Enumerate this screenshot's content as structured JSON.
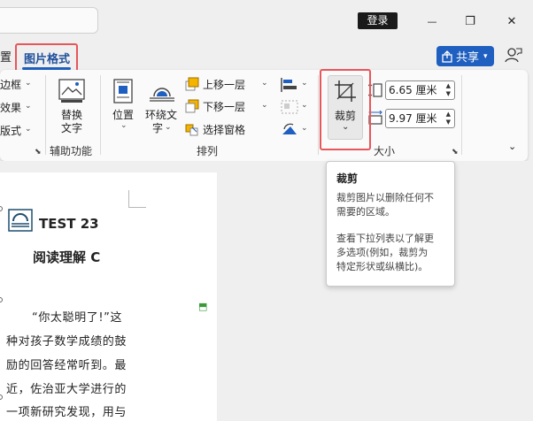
{
  "titlebar": {
    "login_label": "登录",
    "minimize_glyph": "—",
    "restore_glyph": "❐",
    "close_glyph": "✕"
  },
  "tabs": {
    "partial_tab": "置",
    "picture_format": "图片格式"
  },
  "share": {
    "label": "共享",
    "chevron": "⌄"
  },
  "ribbon": {
    "border_label": "边框",
    "effects_label": "效果",
    "layout_label": "版式",
    "alt_text_l1": "替换",
    "alt_text_l2": "文字",
    "accessibility_group": "辅助功能",
    "position_label": "位置",
    "wrap_text_l1": "环绕文",
    "wrap_text_l2": "字",
    "bring_forward": "上移一层",
    "send_backward": "下移一层",
    "selection_pane": "选择窗格",
    "arrange_group": "排列",
    "crop_label": "裁剪",
    "height_value": "6.65 厘米",
    "width_value": "9.97 厘米",
    "size_group": "大小"
  },
  "tooltip": {
    "title": "裁剪",
    "line1": "裁剪图片以删除任何不",
    "line2": "需要的区域。",
    "line3": "查看下拉列表以了解更",
    "line4": "多选项(例如，裁剪为",
    "line5": "特定形状或纵横比)。"
  },
  "document": {
    "test_title": "TEST 23",
    "subtitle": "阅读理解 C",
    "lines": [
      "“你太聪明了!”这",
      "种对孩子数学成绩的鼓",
      "励的回答经常听到。最",
      "近，佐治亚大学进行的",
      "一项新研究发现，用与"
    ]
  },
  "colors": {
    "accent": "#1f5fbf",
    "highlight_border": "#e7565b",
    "login_bg": "#1a1a1a"
  }
}
